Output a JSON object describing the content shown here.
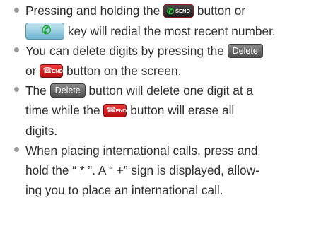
{
  "bullets": [
    {
      "lines": [
        {
          "pre": "Pressing and holding the",
          "post": "button or"
        },
        {
          "post": "key will redial the most recent number."
        }
      ]
    },
    {
      "lines": [
        {
          "pre": "You can delete digits by pressing the"
        },
        {
          "pre": "or",
          "post": "button on the screen."
        }
      ]
    },
    {
      "lines": [
        {
          "pre": "The",
          "mid": "button will delete one digit at a"
        },
        {
          "pre": "time while the",
          "post": "button will erase all"
        },
        {
          "pre": "digits."
        }
      ]
    },
    {
      "lines": [
        {
          "pre": "When placing international calls, press and"
        },
        {
          "pre": "hold the “ * ”. A “ +” sign is displayed, allow-"
        },
        {
          "pre": "ing you to place an international call."
        }
      ]
    }
  ],
  "buttons": {
    "send_label": "SEND",
    "delete_label": "Delete",
    "end_label": "END"
  },
  "icons": {
    "send_button": "phone-handset-icon",
    "call_key": "phone-handset-icon",
    "end_button": "phone-hangup-icon"
  },
  "colors": {
    "text": "#2e2e2e",
    "bullet": "#9a9a9a",
    "send_phone": "#2fd040",
    "end_button": "#d11a1a",
    "key_button": "#8cc8e0",
    "delete_button": "#6a6a6a"
  }
}
